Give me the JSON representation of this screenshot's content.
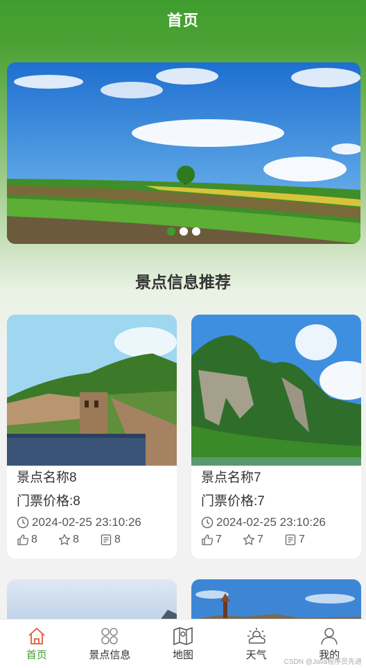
{
  "header": {
    "title": "首页"
  },
  "section": {
    "title": "景点信息推荐"
  },
  "cards": [
    {
      "name": "景点名称8",
      "price": "门票价格:8",
      "time": "2024-02-25 23:10:26",
      "likes": "8",
      "favorites": "8",
      "comments": "8"
    },
    {
      "name": "景点名称7",
      "price": "门票价格:7",
      "time": "2024-02-25 23:10:26",
      "likes": "7",
      "favorites": "7",
      "comments": "7"
    }
  ],
  "tabbar": {
    "items": [
      {
        "label": "首页",
        "icon": "home-icon",
        "active": true
      },
      {
        "label": "景点信息",
        "icon": "grid-icon",
        "active": false
      },
      {
        "label": "地图",
        "icon": "map-icon",
        "active": false
      },
      {
        "label": "天气",
        "icon": "weather-icon",
        "active": false
      },
      {
        "label": "我的",
        "icon": "user-icon",
        "active": false
      }
    ]
  },
  "watermark": "CSDN @Java程序员先进",
  "colors": {
    "accent": "#3f9d2e"
  }
}
